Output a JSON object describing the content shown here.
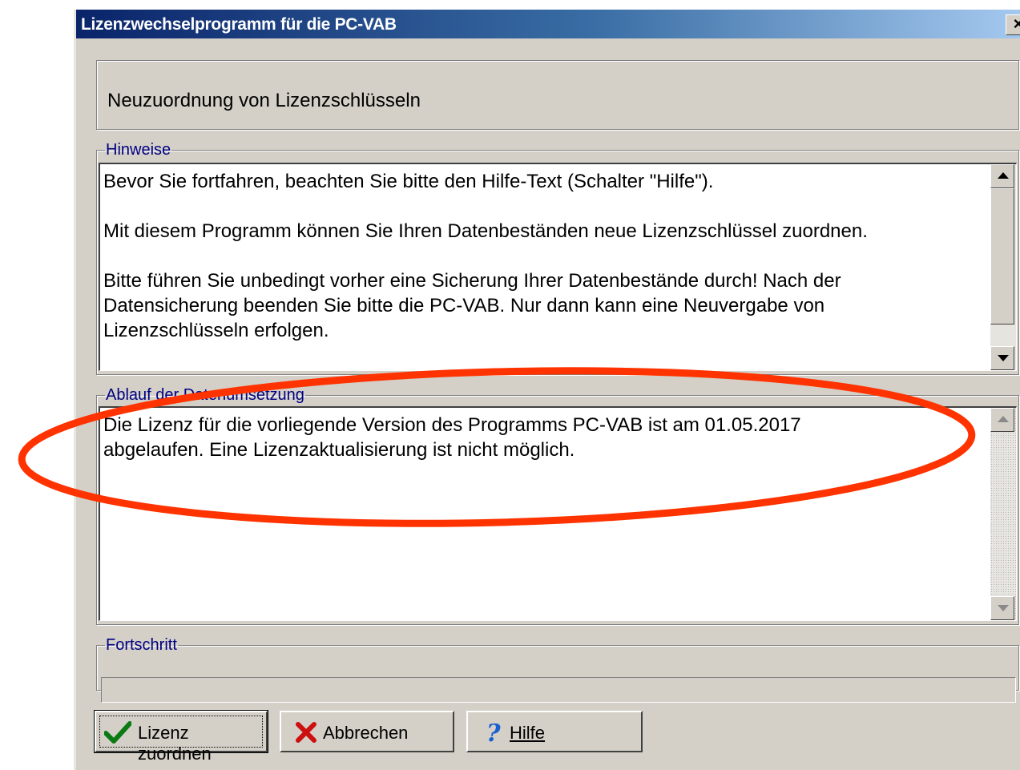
{
  "window": {
    "title": "Lizenzwechselprogramm für die PC-VAB",
    "close_glyph": "×"
  },
  "header": {
    "text": "Neuzuordnung von Lizenzschlüsseln"
  },
  "hinweise": {
    "legend": "Hinweise",
    "text": "Bevor Sie fortfahren, beachten Sie bitte den Hilfe-Text (Schalter \"Hilfe\").\n\nMit diesem Programm können Sie Ihren Datenbeständen neue Lizenzschlüssel zuordnen.\n\nBitte führen Sie unbedingt vorher eine Sicherung Ihrer Datenbestände durch! Nach der\nDatensicherung beenden Sie bitte die PC-VAB. Nur dann kann eine Neuvergabe von\nLizenzschlüsseln erfolgen."
  },
  "ablauf": {
    "legend": "Ablauf der Datenumsetzung",
    "text": "Die Lizenz für die vorliegende Version des Programms PC-VAB ist am 01.05.2017\nabgelaufen. Eine Lizenzaktualisierung ist nicht möglich."
  },
  "fortschritt": {
    "legend": "Fortschritt",
    "progress_fraction": 0
  },
  "buttons": {
    "assign": {
      "label": "Lizenz zuordnen",
      "icon": "checkmark-icon"
    },
    "cancel": {
      "label": "Abbrechen",
      "icon": "red-x-icon"
    },
    "help": {
      "label": "Hilfe",
      "icon": "question-mark-icon"
    }
  },
  "colors": {
    "title_gradient_start": "#0a246a",
    "title_gradient_end": "#a6caf0",
    "legend_text": "#000080",
    "annotation_ellipse": "#ff3300",
    "dialog_face": "#d4d0c8"
  }
}
